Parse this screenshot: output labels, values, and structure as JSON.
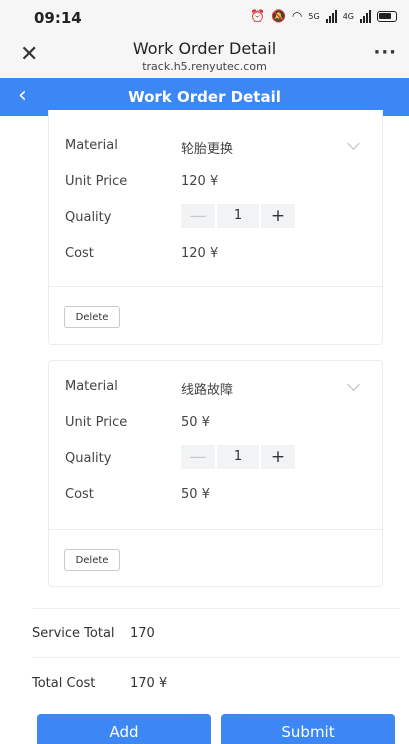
{
  "status_bar": {
    "time": "09:14",
    "net1": "5G",
    "net2": "4G"
  },
  "browser": {
    "title": "Work Order Detail",
    "url": "track.h5.renyutec.com"
  },
  "nav": {
    "title": "Work Order Detail"
  },
  "items": [
    {
      "material_label": "Material",
      "material_value": "轮胎更换",
      "unit_price_label": "Unit Price",
      "unit_price_value": "120 ¥",
      "quality_label": "Quality",
      "quantity": "1",
      "cost_label": "Cost",
      "cost_value": "120 ¥",
      "delete_label": "Delete"
    },
    {
      "material_label": "Material",
      "material_value": "线路故障",
      "unit_price_label": "Unit Price",
      "unit_price_value": "50 ¥",
      "quality_label": "Quality",
      "quantity": "1",
      "cost_label": "Cost",
      "cost_value": "50 ¥",
      "delete_label": "Delete"
    }
  ],
  "totals": {
    "service_label": "Service Total",
    "service_value": "170",
    "cost_label": "Total Cost",
    "cost_value": "170 ¥"
  },
  "buttons": {
    "add": "Add",
    "submit": "Submit"
  },
  "colors": {
    "accent": "#3d87f5"
  }
}
